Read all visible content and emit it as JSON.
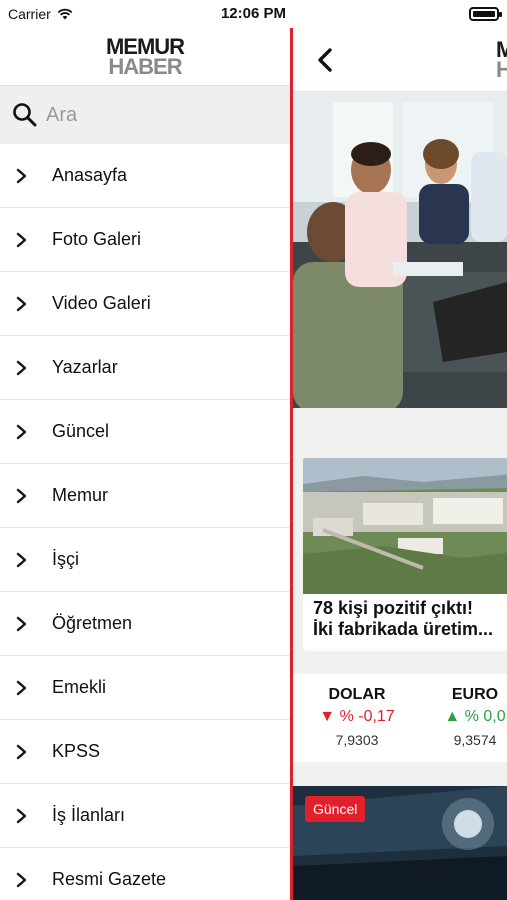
{
  "status_bar": {
    "carrier": "Carrier",
    "time": "12:06 PM"
  },
  "drawer": {
    "logo": {
      "line1": "MEMUR",
      "line2": "HABER"
    },
    "search": {
      "placeholder": "Ara"
    },
    "items": [
      {
        "label": "Anasayfa"
      },
      {
        "label": "Foto Galeri"
      },
      {
        "label": "Video Galeri"
      },
      {
        "label": "Yazarlar"
      },
      {
        "label": "Güncel"
      },
      {
        "label": "Memur"
      },
      {
        "label": "İşçi"
      },
      {
        "label": "Öğretmen"
      },
      {
        "label": "Emekli"
      },
      {
        "label": "KPSS"
      },
      {
        "label": "İş İlanları"
      },
      {
        "label": "Resmi Gazete"
      }
    ]
  },
  "main": {
    "header": {
      "logo_line1": "MEMUR",
      "logo_line2": "HABER"
    },
    "slider": {
      "page_count": 5,
      "active_index": 0
    },
    "news_card": {
      "title_line1": "78 kişi pozitif çıktı!",
      "title_line2": "İki fabrikada üretim..."
    },
    "currencies": [
      {
        "name": "DOLAR",
        "change": "▼ % -0,17",
        "direction": "down",
        "value": "7,9303"
      },
      {
        "name": "EURO",
        "change": "▲ % 0,0",
        "direction": "up",
        "value": "9,3574"
      }
    ],
    "second_card": {
      "badge": "Güncel"
    }
  },
  "colors": {
    "accent_red": "#e0202a",
    "up_green": "#2aa148",
    "drawer_search_bg": "#efefef"
  }
}
